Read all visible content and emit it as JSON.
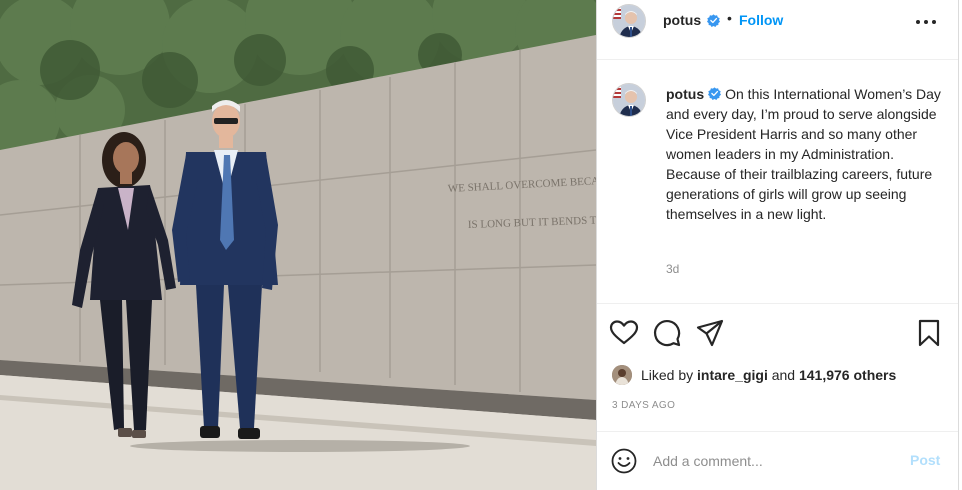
{
  "post": {
    "image_alt": "Vice President Harris and President Biden walking along a stone memorial wall",
    "wall_inscription_line1": "WE SHALL OVERCOME BECAUSE THE ARC",
    "wall_inscription_line2": "IS LONG BUT IT BENDS TOWARD"
  },
  "header": {
    "username": "potus",
    "separator": "•",
    "follow_label": "Follow",
    "verified_icon": "verified-badge-icon",
    "more_icon": "more-options-icon"
  },
  "caption": {
    "username": "potus",
    "text": "On this International Women’s Day and every day, I’m proud to serve alongside Vice President Harris and so many other women leaders in my Administration. Because of their trailblazing careers, future generations of girls will grow up seeing themselves in a new light.",
    "time_ago": "3d"
  },
  "actions": {
    "like_icon": "heart-icon",
    "comment_icon": "comment-icon",
    "share_icon": "share-icon",
    "save_icon": "bookmark-icon"
  },
  "likes": {
    "prefix": "Liked by",
    "user": "intare_gigi",
    "connector": "and",
    "others": "141,976 others"
  },
  "date_label": "3 DAYS AGO",
  "comment": {
    "placeholder": "Add a comment...",
    "post_label": "Post",
    "emoji_icon": "emoji-icon"
  },
  "colors": {
    "link_blue": "#0095f6",
    "post_disabled": "#b2dffc",
    "muted_text": "#8e8e8e",
    "primary_text": "#262626"
  }
}
